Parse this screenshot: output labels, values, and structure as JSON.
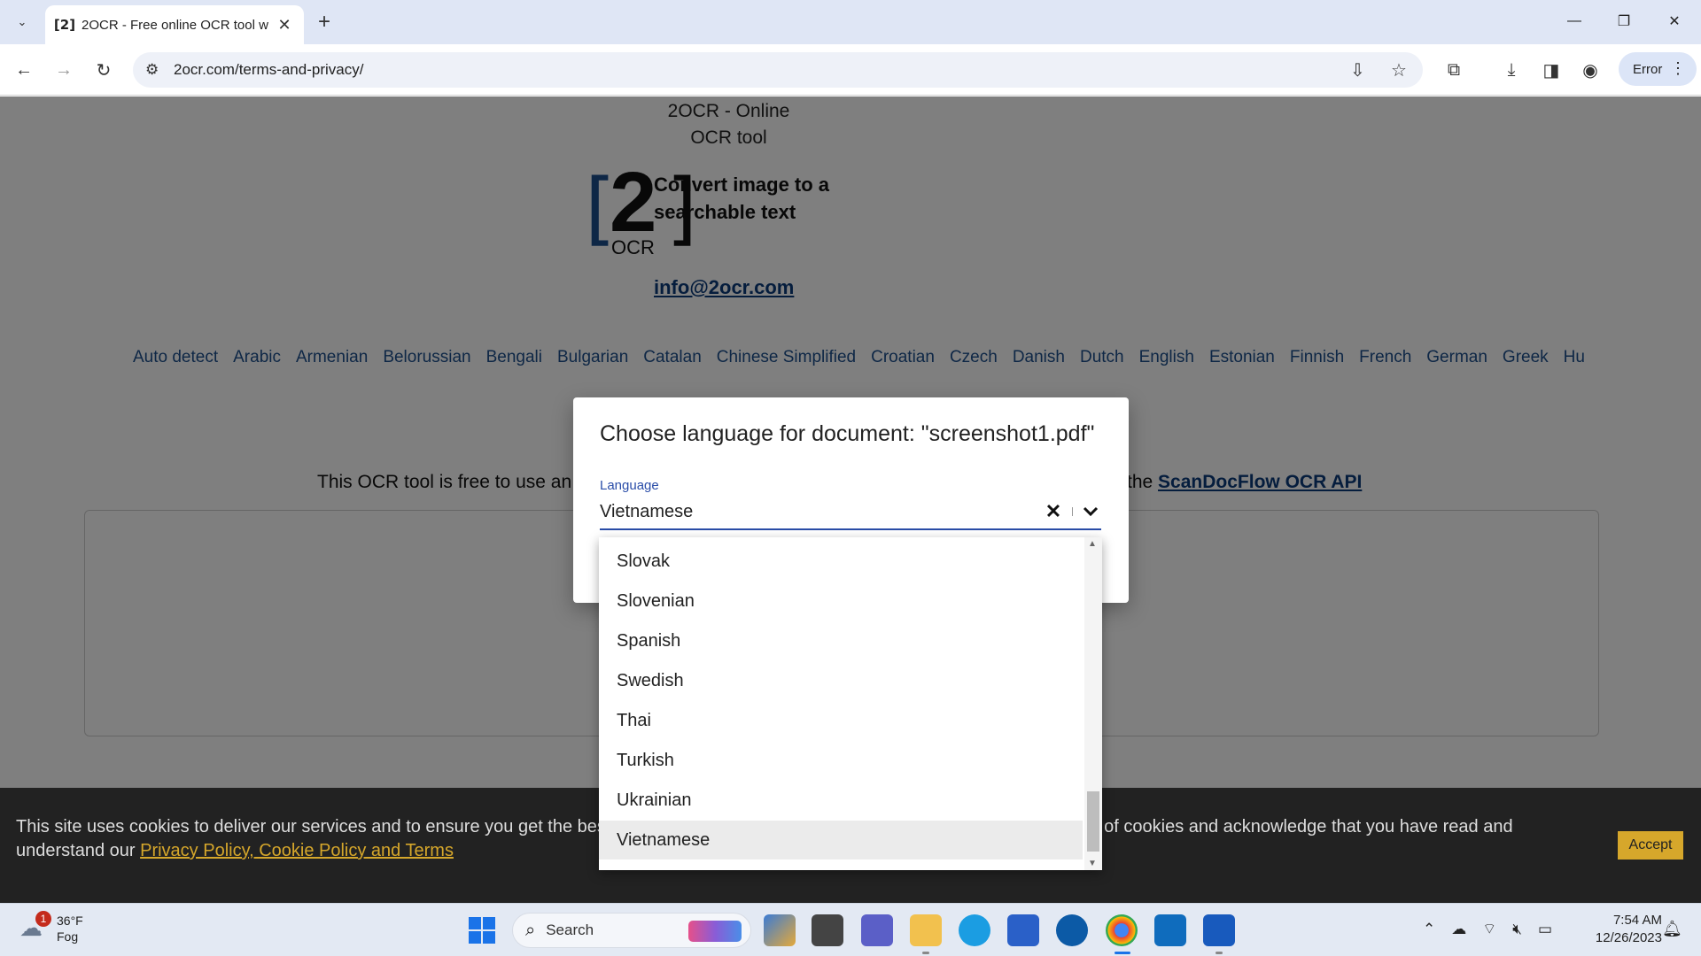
{
  "browser": {
    "tab_title": "2OCR - Free online OCR tool w",
    "tab_favicon": "[2]",
    "url": "2ocr.com/terms-and-privacy/",
    "profile_status": "Error"
  },
  "page": {
    "site_title": "2OCR - Online OCR tool",
    "logo": {
      "big": "2",
      "small": "OCR"
    },
    "tagline": "Convert image to a searchable text",
    "email": "info@2ocr.com",
    "languages": [
      "Auto detect",
      "Arabic",
      "Armenian",
      "Belorussian",
      "Bengali",
      "Bulgarian",
      "Catalan",
      "Chinese Simplified",
      "Croatian",
      "Czech",
      "Danish",
      "Dutch",
      "English",
      "Estonian",
      "Finnish",
      "French",
      "German",
      "Greek",
      "Hu"
    ],
    "free_text": "This OCR tool is free to use an",
    "api_prefix": "the",
    "api_link": "ScanDocFlow OCR API"
  },
  "cookie": {
    "text_start": "This site uses cookies to deliver our services and to ensure you get the best",
    "text_end": "se of cookies and acknowledge that you have read and",
    "text_line2": "understand our",
    "link": "Privacy Policy, Cookie Policy and Terms",
    "accept_label": "Accept"
  },
  "dialog": {
    "title": "Choose language for document: \"screenshot1.pdf\"",
    "field_label": "Language",
    "field_value": "Vietnamese",
    "options": [
      "Slovak",
      "Slovenian",
      "Spanish",
      "Swedish",
      "Thai",
      "Turkish",
      "Ukrainian",
      "Vietnamese"
    ],
    "selected": "Vietnamese"
  },
  "taskbar": {
    "weather_temp": "36°F",
    "weather_desc": "Fog",
    "weather_badge": "1",
    "search_label": "Search",
    "time": "7:54 AM",
    "date": "12/26/2023"
  },
  "colors": {
    "accent": "#2a4da8",
    "link": "#1d4f8c",
    "cookie_accept": "#d6a72b",
    "overlay": "rgba(0,0,0,0.5)"
  }
}
